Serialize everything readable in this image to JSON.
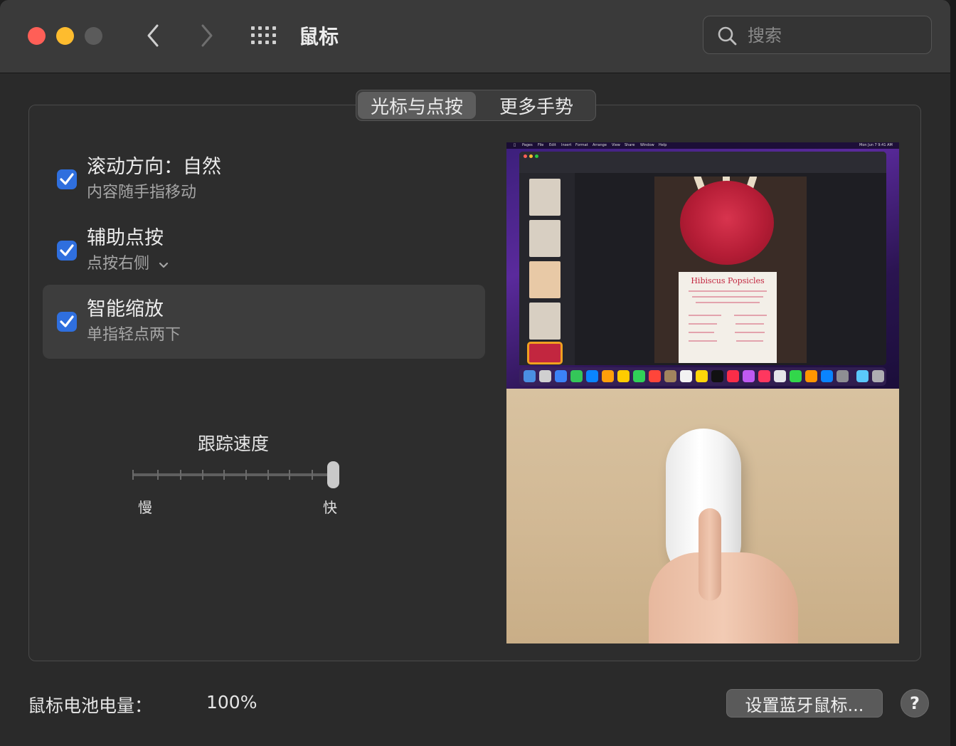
{
  "window": {
    "title": "鼠标",
    "search_placeholder": "搜索"
  },
  "tabs": [
    {
      "label": "光标与点按",
      "active": true
    },
    {
      "label": "更多手势",
      "active": false
    }
  ],
  "options": [
    {
      "title": "滚动方向：自然",
      "subtitle": "内容随手指移动",
      "checked": true
    },
    {
      "title": "辅助点按",
      "subtitle": "点按右侧",
      "checked": true,
      "has_dropdown": true
    },
    {
      "title": "智能缩放",
      "subtitle": "单指轻点两下",
      "checked": true,
      "selected": true
    }
  ],
  "tracking_speed": {
    "label": "跟踪速度",
    "min_label": "慢",
    "max_label": "快",
    "value_fraction": 1.0,
    "tick_count": 10
  },
  "preview": {
    "menubar_items": [
      "Pages",
      "File",
      "Edit",
      "Insert",
      "Format",
      "Arrange",
      "View",
      "Share",
      "Window",
      "Help"
    ],
    "menubar_time": "Mon Jun 7  9:41 AM",
    "document_title": "Hibiscus Popsicles"
  },
  "footer": {
    "battery_label": "鼠标电池电量：",
    "battery_value": "100%",
    "bluetooth_button": "设置蓝牙鼠标...",
    "help_button": "?"
  },
  "colors": {
    "accent": "#2f6fde",
    "close": "#ff5f57",
    "minimize": "#febc2e"
  }
}
